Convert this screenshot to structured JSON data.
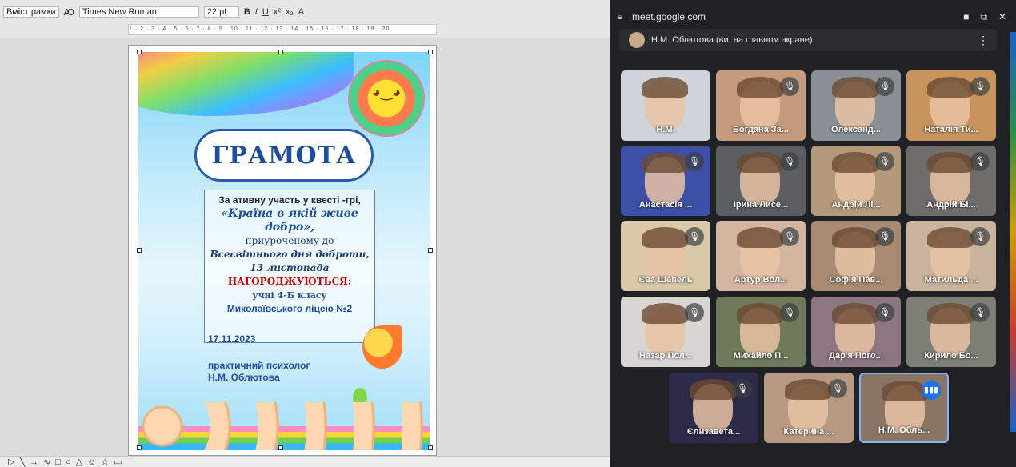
{
  "writer": {
    "toolbar": {
      "frame_dropdown": "Вміст рамки",
      "font_name": "Times New Roman",
      "font_size": "22 pt",
      "bold_icon": "bold-icon",
      "italic_icon": "italic-icon",
      "underline_icon": "underline-icon"
    },
    "ruler_text": "1 · 2 · 3 · 4 · 5 · 6 · 7 · 8 · 9 · 10 · 11 · 12 · 13 · 14 · 15 · 16 · 17 · 18 · 19 · 20",
    "certificate": {
      "title": "ГРАМОТА",
      "line1": "За ативну участь  у квесті -грі,",
      "line2": "«Країна в якій живе добро»,",
      "line3": "приуроченому до",
      "line4": "Всесвітнього дня доброти, 13 листопада",
      "awarded": "НАГОРОДЖУЮТЬСЯ:",
      "line6": "учні 4-Б класу",
      "line7": "Миколаївського ліцею №2",
      "date": "17.11.2023",
      "signer_role": "практичний психолог",
      "signer_name": "Н.М. Облютова"
    },
    "drawing_toolbar_icons": [
      "select-icon",
      "line-icon",
      "arrow-icon",
      "curve-icon",
      "rectangle-icon",
      "ellipse-icon",
      "triangle-icon",
      "smiley-icon",
      "star-icon",
      "callout-icon"
    ]
  },
  "meet": {
    "url": "meet.google.com",
    "pinned_label": "Н.М. Облютова (ви, на главном экране)",
    "colors": {
      "bg": "#202124",
      "accent": "#1a73e8",
      "speaking_border": "#8ab4f8"
    },
    "tiles": [
      {
        "name": "Н.М.",
        "muted": false,
        "bg": "#cfd4da"
      },
      {
        "name": "Богдана За...",
        "muted": true,
        "bg": "#c69a7c"
      },
      {
        "name": "Олександ...",
        "muted": true,
        "bg": "#8a8f96"
      },
      {
        "name": "Наталія Ти...",
        "muted": true,
        "bg": "#c7935d"
      },
      {
        "name": "Анастасія ...",
        "muted": true,
        "bg": "#3e4fa8"
      },
      {
        "name": "Ірина Лисе...",
        "muted": true,
        "bg": "#5a5e63"
      },
      {
        "name": "Андрій Лі...",
        "muted": true,
        "bg": "#b49a7a"
      },
      {
        "name": "Андрій Бі...",
        "muted": true,
        "bg": "#6f6c6a"
      },
      {
        "name": "Єва Шепель",
        "muted": true,
        "bg": "#d9c9a8"
      },
      {
        "name": "Артур Вол...",
        "muted": true,
        "bg": "#d4b6a0"
      },
      {
        "name": "Софія Пав...",
        "muted": true,
        "bg": "#a98a72"
      },
      {
        "name": "Матильда ...",
        "muted": true,
        "bg": "#c9b39c"
      },
      {
        "name": "Назар Пол...",
        "muted": true,
        "bg": "#d8d6d2"
      },
      {
        "name": "Михайло П...",
        "muted": true,
        "bg": "#6e7a5a"
      },
      {
        "name": "Дар'я Пого...",
        "muted": true,
        "bg": "#8c7680"
      },
      {
        "name": "Кирило Бо...",
        "muted": true,
        "bg": "#7d7f76"
      },
      {
        "name": "Єлизавета...",
        "muted": true,
        "bg": "#2d2a4a"
      },
      {
        "name": "Катерина ...",
        "muted": true,
        "bg": "#b79a84"
      },
      {
        "name": "Н.М. Обль...",
        "muted": false,
        "bg": "#8a7564",
        "speaking": true
      }
    ]
  }
}
